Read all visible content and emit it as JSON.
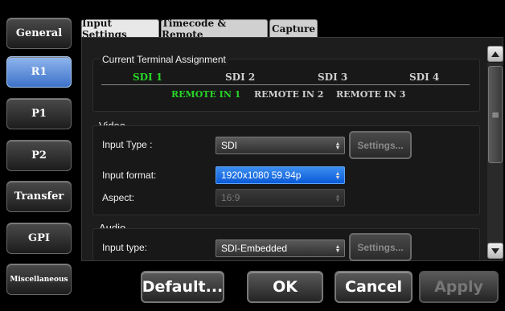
{
  "nav": {
    "items": [
      {
        "label": "General",
        "active": false
      },
      {
        "label": "R1",
        "active": true
      },
      {
        "label": "P1",
        "active": false
      },
      {
        "label": "P2",
        "active": false
      },
      {
        "label": "Transfer",
        "active": false
      },
      {
        "label": "GPI",
        "active": false
      },
      {
        "label": "Miscellaneous",
        "active": false
      }
    ]
  },
  "tabs": [
    {
      "label": "Input Settings",
      "active": true
    },
    {
      "label": "Timecode & Remote",
      "active": false
    },
    {
      "label": "Capture",
      "active": false
    }
  ],
  "terminal": {
    "title": "Current Terminal Assignment",
    "sdi": [
      "SDI 1",
      "SDI 2",
      "SDI 3",
      "SDI 4"
    ],
    "sdi_selected": 0,
    "remote": [
      "REMOTE IN 1",
      "REMOTE IN 2",
      "REMOTE IN 3"
    ],
    "remote_selected": 0,
    "selected_color": "#28d428"
  },
  "video": {
    "title": "Video",
    "input_type_label": "Input Type :",
    "input_type_value": "SDI",
    "settings_label": "Settings...",
    "input_format_label": "Input format:",
    "input_format_value": "1920x1080 59.94p",
    "aspect_label": "Aspect:",
    "aspect_value": "16:9"
  },
  "audio": {
    "title": "Audio",
    "input_type_label": "Input type:",
    "input_type_value": "SDI-Embedded",
    "settings_label": "Settings..."
  },
  "buttons": {
    "default": "Default...",
    "ok": "OK",
    "cancel": "Cancel",
    "apply": "Apply"
  },
  "icons": {
    "scroll_up": "triangle-up-icon",
    "scroll_down": "triangle-down-icon",
    "scroll_grip": "grip-lines-icon",
    "dropdown": "updown-arrows-icon"
  }
}
